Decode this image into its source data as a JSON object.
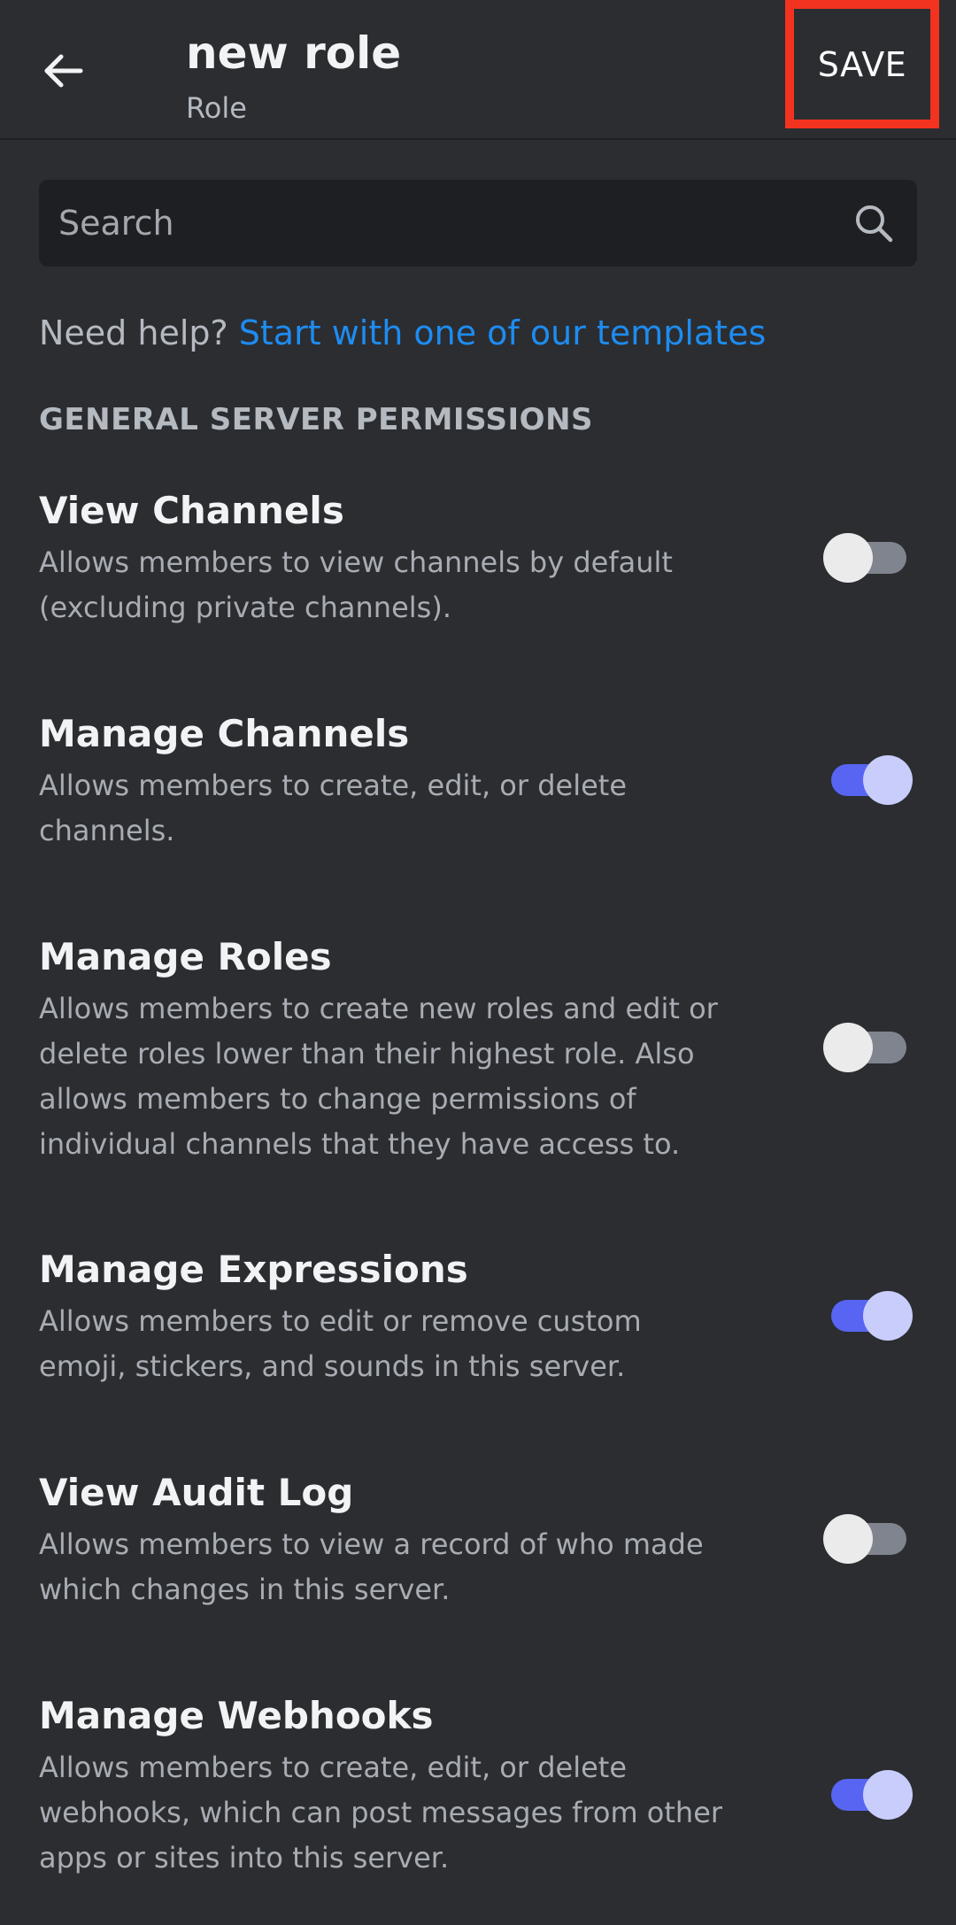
{
  "header": {
    "title": "new role",
    "subtitle": "Role",
    "save_label": "SAVE"
  },
  "search": {
    "placeholder": "Search"
  },
  "help": {
    "prefix": "Need help? ",
    "link": "Start with one of our templates"
  },
  "section": {
    "title": "GENERAL SERVER PERMISSIONS"
  },
  "permissions": [
    {
      "title": "View Channels",
      "description": "Allows members to view channels by default (excluding private channels).",
      "enabled": false
    },
    {
      "title": "Manage Channels",
      "description": "Allows members to create, edit, or delete channels.",
      "enabled": true
    },
    {
      "title": "Manage Roles",
      "description": "Allows members to create new roles and edit or delete roles lower than their highest role. Also allows members to change permissions of individual channels that they have access to.",
      "enabled": false
    },
    {
      "title": "Manage Expressions",
      "description": "Allows members to edit or remove custom emoji, stickers, and sounds in this server.",
      "enabled": true
    },
    {
      "title": "View Audit Log",
      "description": "Allows members to view a record of who made which changes in this server.",
      "enabled": false
    },
    {
      "title": "Manage Webhooks",
      "description": "Allows members to create, edit, or delete webhooks, which can post messages from other apps or sites into this server.",
      "enabled": true
    }
  ],
  "icons": {
    "back": "arrow-left-icon",
    "search": "search-icon"
  },
  "colors": {
    "background": "#2b2d31",
    "search_background": "#1e1f22",
    "link": "#1e8cf0",
    "toggle_on": "#5865f2",
    "toggle_off": "#80848e",
    "save_highlight": "#f2331f"
  }
}
